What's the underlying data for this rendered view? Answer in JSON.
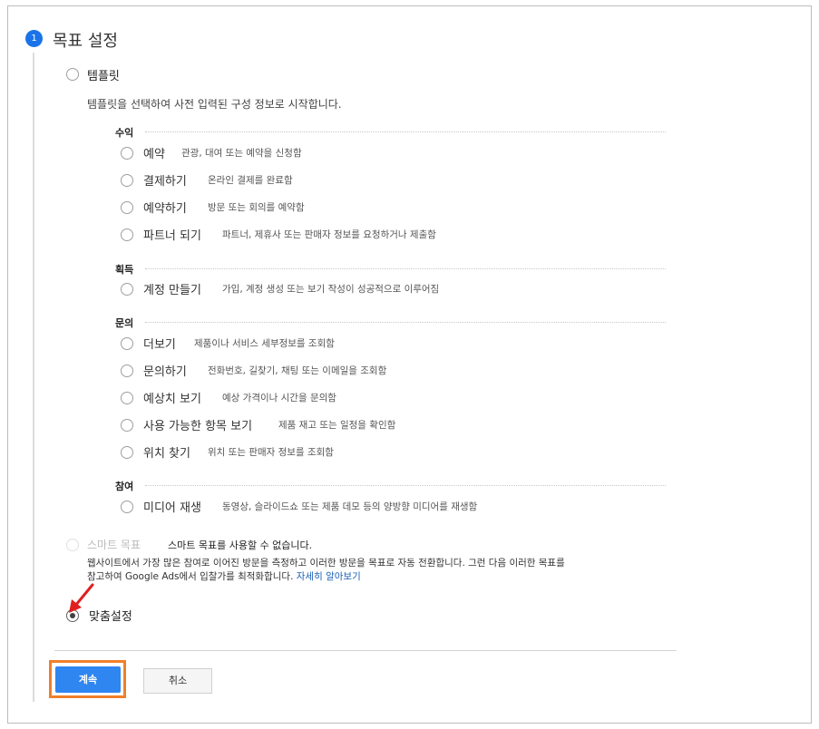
{
  "step": {
    "number": "1",
    "title": "목표 설정"
  },
  "template": {
    "label": "템플릿",
    "description": "템플릿을 선택하여 사전 입력된 구성 정보로 시작합니다."
  },
  "categories": [
    {
      "label": "수익",
      "options": [
        {
          "label": "예약",
          "desc": "관광, 대여 또는 예약을 신청함"
        },
        {
          "label": "결제하기",
          "desc": "온라인 결제를 완료함"
        },
        {
          "label": "예약하기",
          "desc": "방문 또는 회의를 예약함"
        },
        {
          "label": "파트너 되기",
          "desc": "파트너, 제휴사 또는 판매자 정보를 요청하거나 제출함"
        }
      ]
    },
    {
      "label": "획득",
      "options": [
        {
          "label": "계정 만들기",
          "desc": "가입, 계정 생성 또는 보기 작성이 성공적으로 이루어짐"
        }
      ]
    },
    {
      "label": "문의",
      "options": [
        {
          "label": "더보기",
          "desc": "제품이나 서비스 세부정보를 조회함"
        },
        {
          "label": "문의하기",
          "desc": "전화번호, 길찾기, 채팅 또는 이메일을 조회함"
        },
        {
          "label": "예상치 보기",
          "desc": "예상 가격이나 시간을 문의함"
        },
        {
          "label": "사용 가능한 항목 보기",
          "desc": "제품 재고 또는 일정을 확인함"
        },
        {
          "label": "위치 찾기",
          "desc": "위치 또는 판매자 정보를 조회함"
        }
      ]
    },
    {
      "label": "참여",
      "options": [
        {
          "label": "미디어 재생",
          "desc": "동영상, 슬라이드쇼 또는 제품 데모 등의 양방향 미디어를 재생함"
        }
      ]
    }
  ],
  "smart_goal": {
    "label": "스마트 목표",
    "note": "스마트 목표를 사용할 수 없습니다.",
    "desc_line1": "웹사이트에서 가장 많은 참여로 이어진 방문을 측정하고 이러한 방문을 목표로 자동 전환합니다. 그런 다음 이러한 목표를",
    "desc_line2": "참고하여 Google Ads에서 입찰가를 최적화합니다.",
    "link": "자세히 알아보기"
  },
  "custom": {
    "label": "맞춤설정"
  },
  "buttons": {
    "continue": "계속",
    "cancel": "취소"
  },
  "colors": {
    "accent": "#1a73e8",
    "button": "#2f86f0",
    "highlight": "#f07f2a",
    "arrow": "#e02020"
  }
}
